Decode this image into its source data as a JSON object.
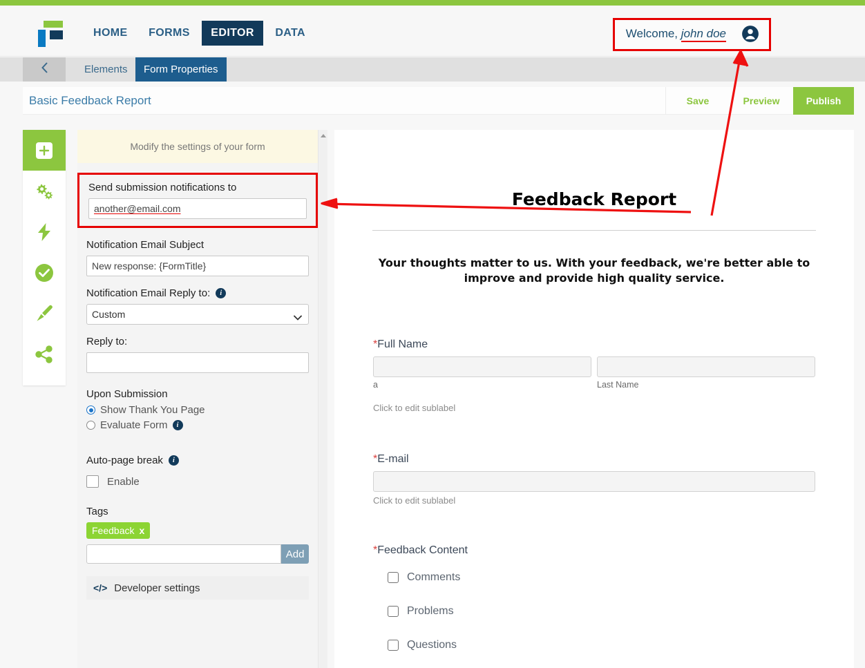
{
  "brand": {
    "accent_green": "#8cc63f",
    "navy": "#123a5a",
    "tab_blue": "#1d5d8e",
    "annotation_red": "#e60000",
    "logo_name": "form-builder-logo"
  },
  "navbar": {
    "links": [
      {
        "label": "HOME",
        "active": false
      },
      {
        "label": "FORMS",
        "active": false
      },
      {
        "label": "EDITOR",
        "active": true
      },
      {
        "label": "DATA",
        "active": false
      }
    ],
    "welcome_prefix": "Welcome,",
    "welcome_user": "john doe",
    "avatar_icon": "user-avatar-icon"
  },
  "subtabs": {
    "back_icon": "chevron-left-icon",
    "elements_label": "Elements",
    "properties_label": "Form Properties"
  },
  "titlebar": {
    "form_title": "Basic Feedback Report",
    "save_label": "Save",
    "preview_label": "Preview",
    "publish_label": "Publish"
  },
  "rail": {
    "items": [
      {
        "icon": "add-element-icon",
        "active": true
      },
      {
        "icon": "gears-settings-icon",
        "active": false
      },
      {
        "icon": "lightning-bolt-icon",
        "active": false
      },
      {
        "icon": "check-circle-icon",
        "active": false
      },
      {
        "icon": "paintbrush-icon",
        "active": false
      },
      {
        "icon": "share-icon",
        "active": false
      }
    ]
  },
  "settings": {
    "hint": "Modify the settings of your form",
    "notifications_label": "Send submission notifications to",
    "notifications_value": "another@email.com",
    "subject_label": "Notification Email Subject",
    "subject_value": "New response: {FormTitle}",
    "replyto_select_label": "Notification Email Reply to:",
    "replyto_select_value": "Custom",
    "replyto_select_options": [
      "Custom"
    ],
    "replyto_label": "Reply to:",
    "replyto_value": "",
    "upon_submission_label": "Upon Submission",
    "upon_submission_options": [
      {
        "label": "Show Thank You Page",
        "selected": true,
        "info": false
      },
      {
        "label": "Evaluate Form",
        "selected": false,
        "info": true
      }
    ],
    "autopagebreak_label": "Auto-page break",
    "autopagebreak_enable_label": "Enable",
    "autopagebreak_enabled": false,
    "tags_label": "Tags",
    "tags": [
      {
        "label": "Feedback",
        "remove": "x"
      }
    ],
    "tag_input_value": "",
    "add_button_label": "Add",
    "developer_settings_label": "Developer settings",
    "developer_icon": "code-brackets-icon",
    "scroll_up_icon": "scroll-up-arrow-icon"
  },
  "preview": {
    "title": "Feedback Report",
    "subtitle": "Your thoughts matter to us. With your feedback, we're better able to improve and provide high quality service.",
    "fields": [
      {
        "label": "Full Name",
        "required": "*",
        "sublabels": [
          "a",
          "Last Name"
        ],
        "hint": "Click to edit sublabel"
      },
      {
        "label": "E-mail",
        "required": "*",
        "sublabels": [],
        "hint": "Click to edit sublabel"
      }
    ],
    "checkbox_group": {
      "label": "Feedback Content",
      "required": "*",
      "options": [
        "Comments",
        "Problems",
        "Questions"
      ]
    }
  }
}
